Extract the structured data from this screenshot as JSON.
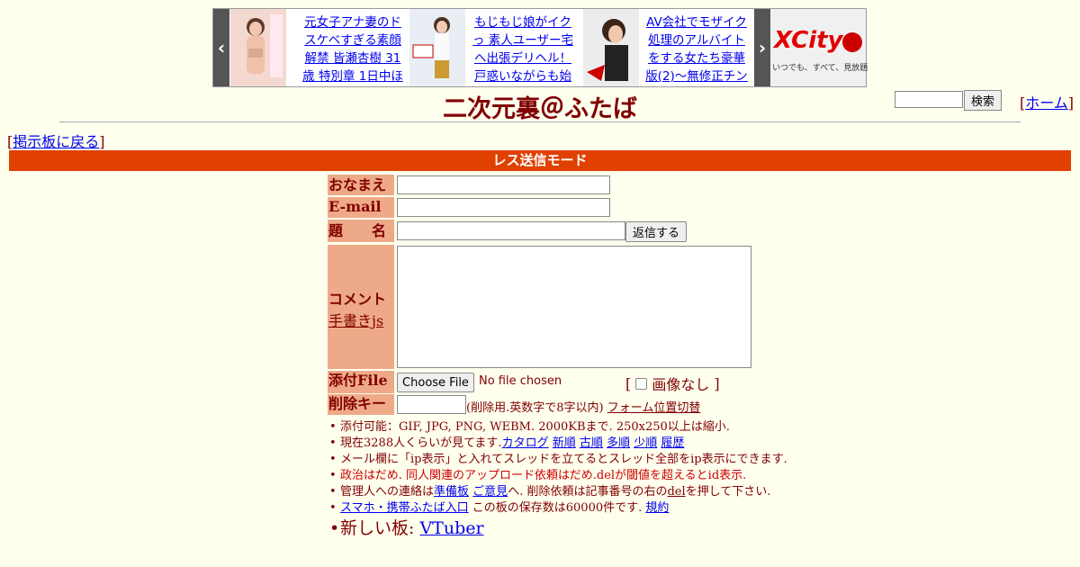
{
  "ad": {
    "prev_label": "‹",
    "next_label": "›",
    "items": [
      {
        "text": "元女子アナ妻のドスケベすぎる素顔解禁 皆瀬杏樹 31歳 特別章 1日中ほ"
      },
      {
        "text": "もじもじ娘がイクっ 素人ユーザー宅へ出張デリヘル！戸惑いながらも始"
      },
      {
        "text": "AV会社でモザイク処理のアルバイトをする女たち豪華版(2)～無修正チン"
      }
    ],
    "xcity_logo": "XCity",
    "xcity_tagline": "いつでも、すべて、見放題"
  },
  "header": {
    "title": "二次元裏＠ふたば",
    "search_button": "検索",
    "home_link": "ホーム"
  },
  "nav": {
    "back_link": "掲示板に戻る"
  },
  "mode_bar": "レス送信モード",
  "form": {
    "name_label": "おなまえ",
    "email_label": "E-mail",
    "subject_label": "題　　名",
    "submit_button": "返信する",
    "comment_label": "コメント",
    "handwrite_link": "手書きjs",
    "file_label": "添付File",
    "choose_file_button": "Choose File",
    "no_file_text": "No file chosen",
    "no_image_text": "画像なし",
    "delkey_label": "削除キー",
    "delkey_note": "(削除用.英数字で8字以内)",
    "form_position_link": "フォーム位置切替"
  },
  "rules": {
    "r1": "添付可能：GIF, JPG, PNG, WEBM. 2000KBまで. 250x250以上は縮小.",
    "r2_prefix": "現在3288人くらいが見てます.",
    "r2_links": [
      "カタログ",
      "新順",
      "古順",
      "多順",
      "少順",
      "履歴"
    ],
    "r3": "メール欄に「ip表示」と入れてスレッドを立てるとスレッド全部をip表示にできます.",
    "r4": "政治はだめ. 同人関連のアップロード依頼はだめ.delが閾値を超えるとid表示.",
    "r5_prefix": "管理人への連絡は",
    "r5_link1": "準備板",
    "r5_link2": "ご意見",
    "r5_mid": "へ. 削除依頼は記事番号の右の",
    "r5_link3": "del",
    "r5_suffix": "を押して下さい.",
    "r6_link": "スマホ・携帯ふたば入口",
    "r6_mid": " この板の保存数は60000件です. ",
    "r6_link2": "規約",
    "r7_prefix": "新しい板: ",
    "r7_link": "VTuber"
  }
}
